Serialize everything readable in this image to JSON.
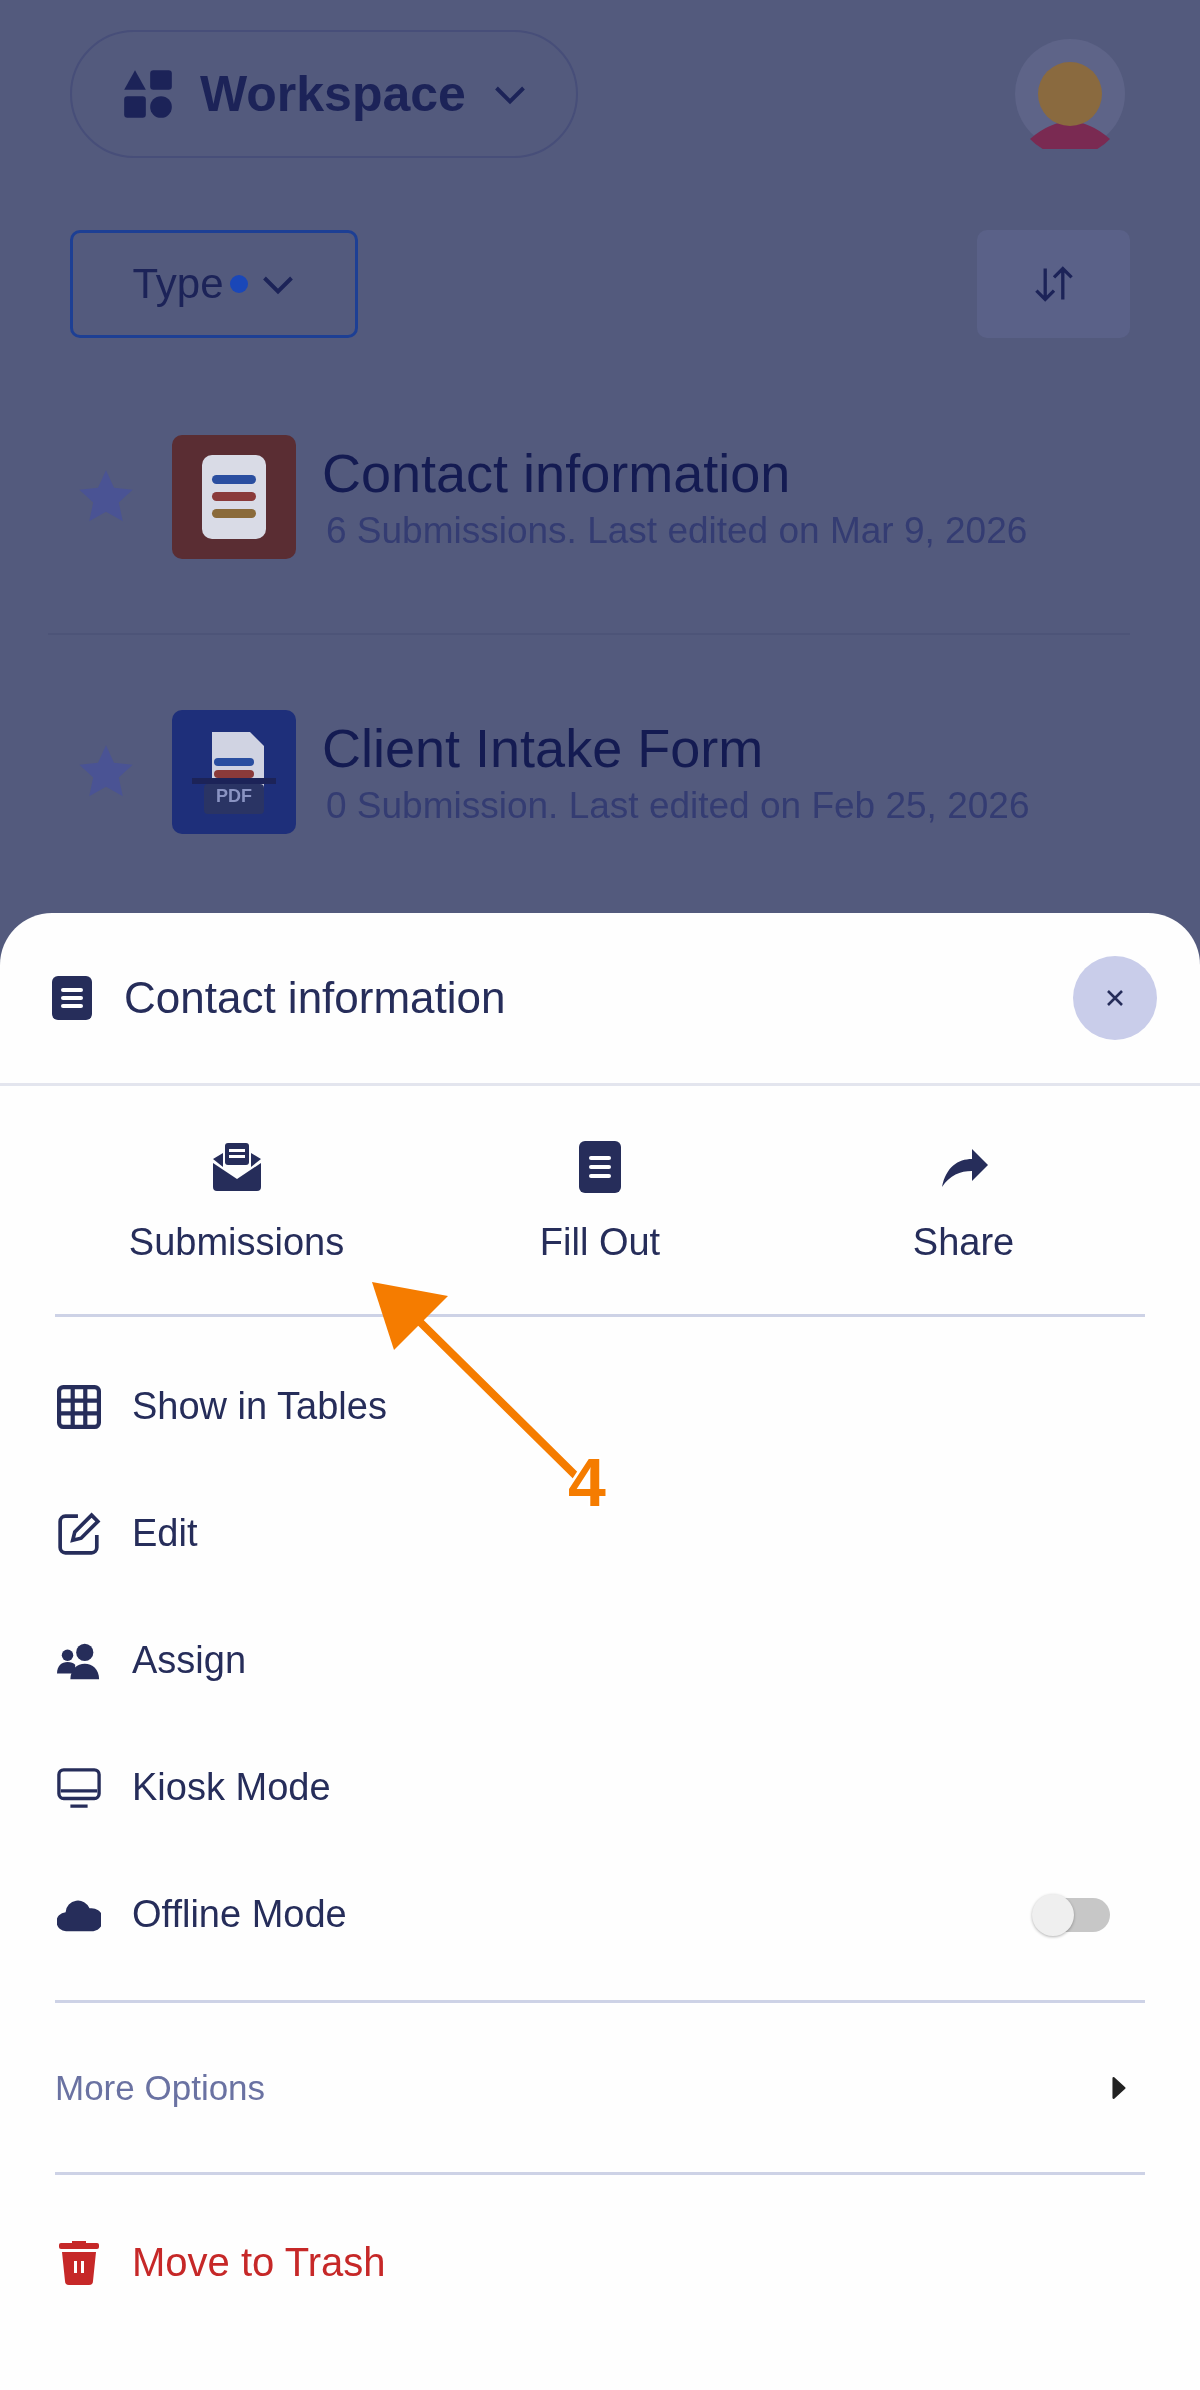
{
  "top_bar": {
    "workspace": "Workspace"
  },
  "filter": {
    "label": "Type",
    "active": true
  },
  "forms": [
    {
      "title": "Contact information",
      "subtitle": "6 Submissions. Last edited on Mar 9, 2026",
      "starred": false,
      "kind": "form"
    },
    {
      "title": "Client Intake Form",
      "subtitle": "0 Submission. Last edited on Feb 25, 2026",
      "starred": false,
      "kind": "pdf",
      "badge": "PDF"
    }
  ],
  "sheet": {
    "title": "Contact information",
    "actions": [
      {
        "label": "Submissions",
        "kind": "submissions"
      },
      {
        "label": "Fill Out",
        "kind": "fill"
      },
      {
        "label": "Share",
        "kind": "share"
      }
    ],
    "menu": [
      {
        "label": "Show in Tables",
        "kind": "tables"
      },
      {
        "label": "Edit",
        "kind": "edit"
      },
      {
        "label": "Assign",
        "kind": "assign"
      },
      {
        "label": "Kiosk Mode",
        "kind": "kiosk"
      },
      {
        "label": "Offline Mode",
        "kind": "offline",
        "on": false
      }
    ],
    "more_options": "More Options",
    "trash": "Move to Trash"
  },
  "annotation": {
    "label": "4"
  }
}
